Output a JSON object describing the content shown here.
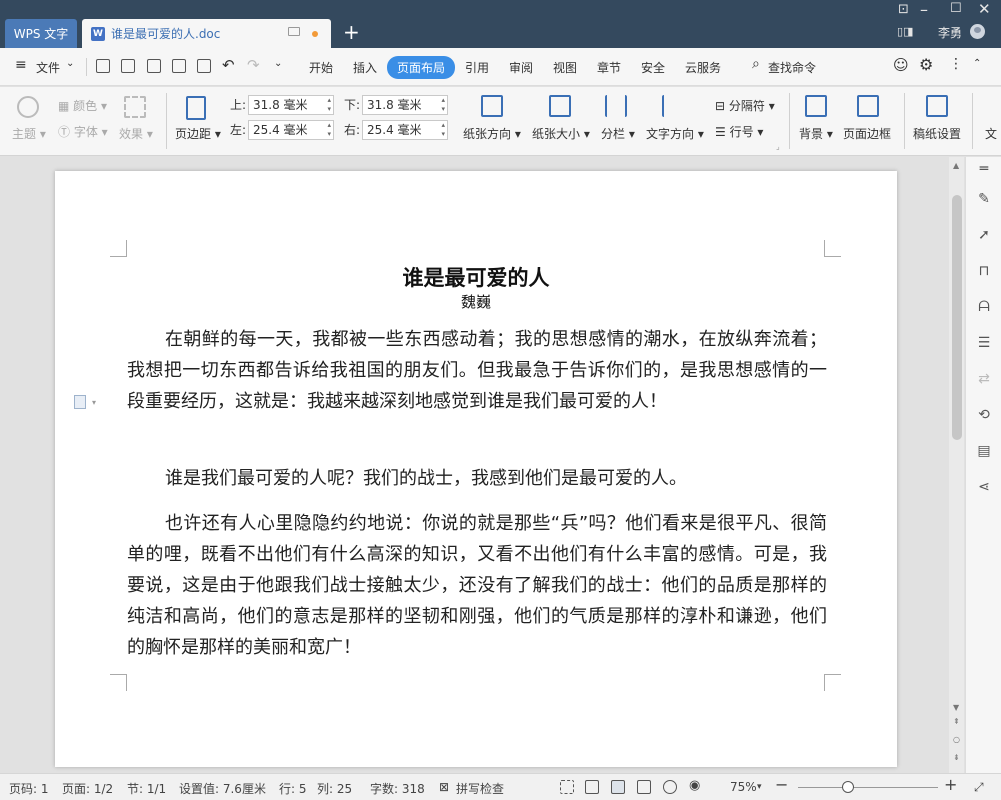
{
  "titlebar": {
    "app_tab": "WPS 文字",
    "doc_tab": "谁是最可爱的人.doc",
    "doc_icon": "W",
    "new_tab": "+",
    "user": "李勇"
  },
  "menubar": {
    "file": "文件",
    "items": [
      "开始",
      "插入",
      "页面布局",
      "引用",
      "审阅",
      "视图",
      "章节",
      "安全",
      "云服务"
    ],
    "active": "页面布局",
    "search": "查找命令"
  },
  "ribbon": {
    "theme": "主题",
    "color": "颜色",
    "font": "字体",
    "effect": "效果",
    "margins": "页边距",
    "margin_top_label": "上:",
    "margin_top": "31.8 毫米",
    "margin_bottom_label": "下:",
    "margin_bottom": "31.8 毫米",
    "margin_left_label": "左:",
    "margin_left": "25.4 毫米",
    "margin_right_label": "右:",
    "margin_right": "25.4 毫米",
    "orientation": "纸张方向",
    "size": "纸张大小",
    "columns": "分栏",
    "text_direction": "文字方向",
    "separator": "分隔符",
    "line_numbers": "行号",
    "background": "背景",
    "page_border": "页面边框",
    "manuscript": "稿纸设置",
    "cut_off": "文"
  },
  "document": {
    "title": "谁是最可爱的人",
    "author": "魏巍",
    "paragraphs": [
      "在朝鲜的每一天，我都被一些东西感动着；我的思想感情的潮水，在放纵奔流着；我想把一切东西都告诉给我祖国的朋友们。但我最急于告诉你们的，是我思想感情的一段重要经历，这就是：我越来越深刻地感觉到谁是我们最可爱的人！",
      "谁是我们最可爱的人呢？我们的战士，我感到他们是最可爱的人。",
      "也许还有人心里隐隐约约地说：你说的就是那些“兵”吗？他们看来是很平凡、很简单的哩，既看不出他们有什么高深的知识，又看不出他们有什么丰富的感情。可是，我要说，这是由于他跟我们战士接触太少，还没有了解我们的战士：他们的品质是那样的纯洁和高尚，他们的意志是那样的坚韧和刚强，他们的气质是那样的淳朴和谦逊，他们的胸怀是那样的美丽和宽广！"
    ]
  },
  "statusbar": {
    "page_no": "页码: 1",
    "pages": "页面: 1/2",
    "section": "节: 1/1",
    "setting": "设置值: 7.6厘米",
    "row": "行: 5",
    "col": "列: 25",
    "words": "字数: 318",
    "spell": "拼写检查",
    "zoom": "75%",
    "zoom_level": 0.36
  }
}
